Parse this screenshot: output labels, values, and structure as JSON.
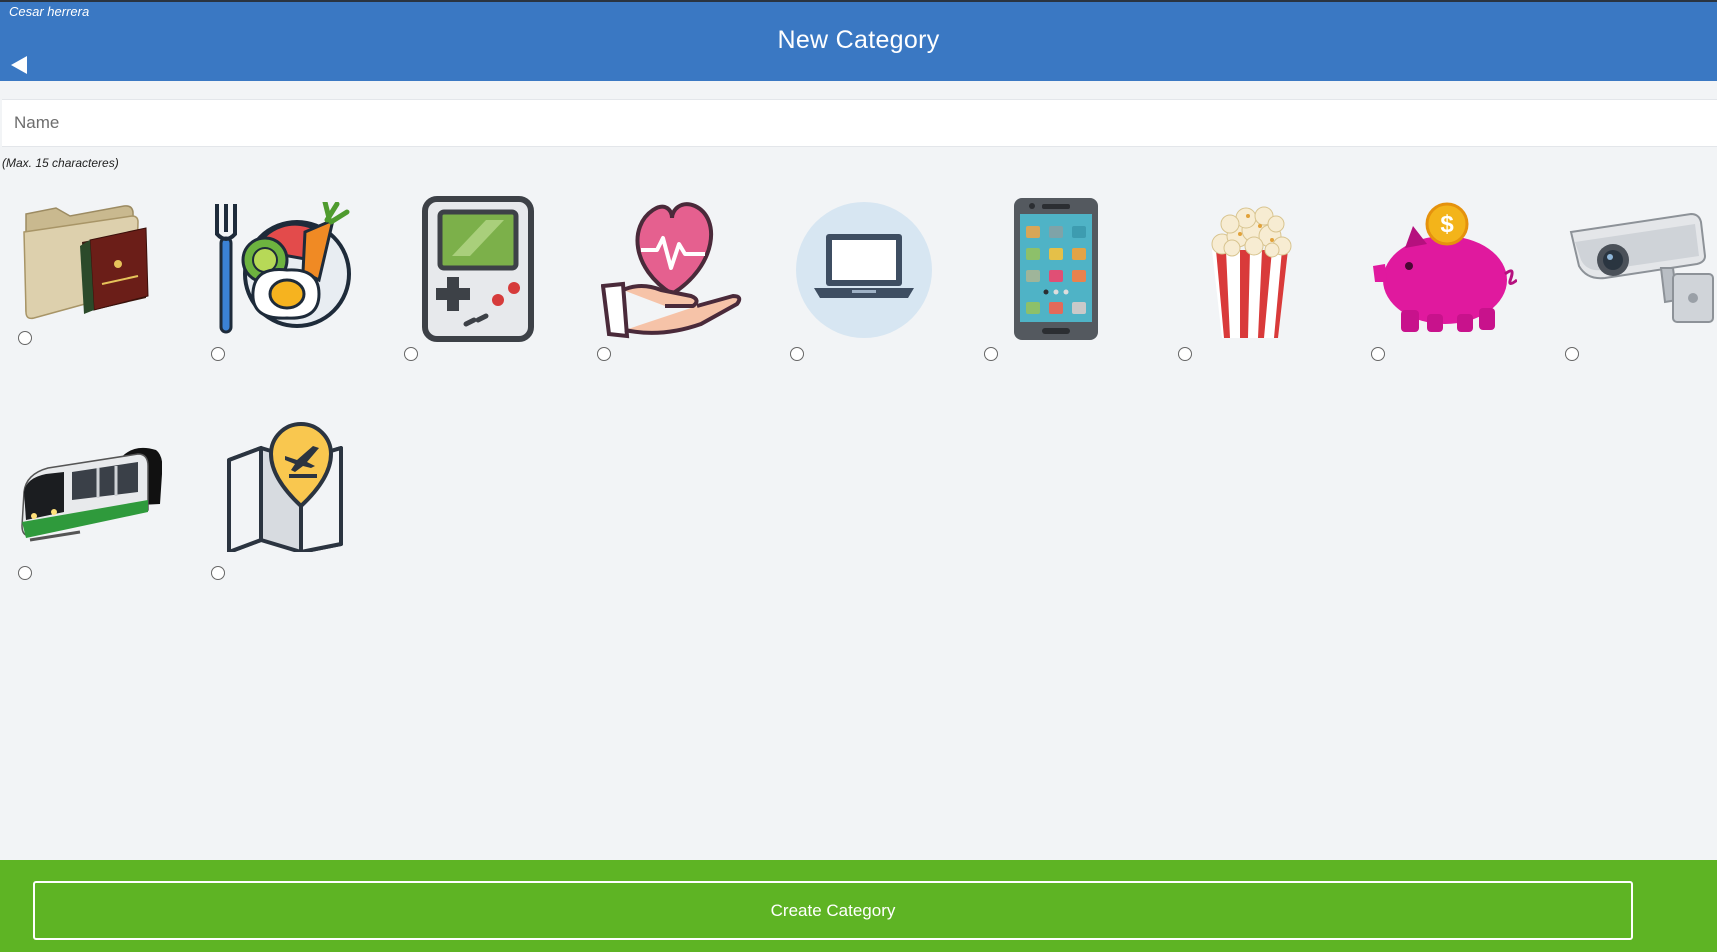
{
  "header": {
    "user_name": "Cesar herrera",
    "title": "New Category",
    "back_icon": "back-arrow-icon"
  },
  "form": {
    "name_placeholder": "Name",
    "name_value": "",
    "hint": "(Max. 15 characteres)"
  },
  "categories": [
    {
      "icon": "folder-books-icon",
      "selected": false
    },
    {
      "icon": "food-plate-icon",
      "selected": false
    },
    {
      "icon": "game-console-icon",
      "selected": false
    },
    {
      "icon": "health-heart-hand-icon",
      "selected": false
    },
    {
      "icon": "laptop-icon",
      "selected": false
    },
    {
      "icon": "smartphone-icon",
      "selected": false
    },
    {
      "icon": "popcorn-icon",
      "selected": false
    },
    {
      "icon": "piggy-bank-icon",
      "selected": false
    },
    {
      "icon": "security-camera-icon",
      "selected": false
    },
    {
      "icon": "train-icon",
      "selected": false
    },
    {
      "icon": "travel-map-icon",
      "selected": false
    }
  ],
  "footer": {
    "create_label": "Create Category"
  },
  "colors": {
    "header_bg": "#3a78c3",
    "footer_bg": "#5eb424",
    "page_bg": "#f2f4f6"
  }
}
